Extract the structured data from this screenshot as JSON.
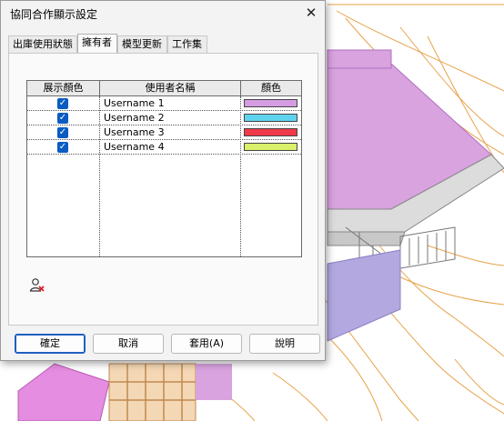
{
  "dialog": {
    "title": "協同合作顯示設定",
    "close_glyph": "✕"
  },
  "tabs": [
    {
      "label": "出庫使用狀態",
      "active": false
    },
    {
      "label": "擁有者",
      "active": true
    },
    {
      "label": "模型更新",
      "active": false
    },
    {
      "label": "工作集",
      "active": false
    }
  ],
  "table": {
    "headers": [
      "展示顏色",
      "使用者名稱",
      "顏色"
    ],
    "rows": [
      {
        "checked": true,
        "user": "Username 1",
        "color": "#d59be3"
      },
      {
        "checked": true,
        "user": "Username 2",
        "color": "#5fd3ee"
      },
      {
        "checked": true,
        "user": "Username 3",
        "color": "#f03a4a"
      },
      {
        "checked": true,
        "user": "Username 4",
        "color": "#d9f06a"
      }
    ]
  },
  "icons": {
    "checkmark": "✓",
    "remove_user": "remove-user-icon"
  },
  "buttons": {
    "ok": "確定",
    "cancel": "取消",
    "apply": "套用(A)",
    "help": "說明"
  },
  "colors": {
    "accent": "#1f5fbf",
    "checkbox": "#0a5cc2"
  }
}
